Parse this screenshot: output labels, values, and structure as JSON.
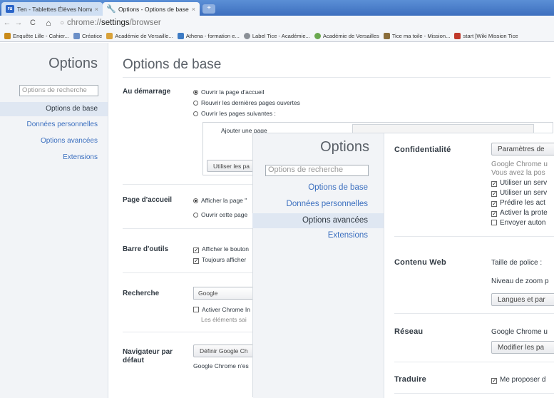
{
  "tabs": [
    {
      "label": "Ten - Tablettes Élèves Nomad",
      "favicon": "ru-logo-icon",
      "close": "×"
    },
    {
      "label": "Options - Options de base",
      "favicon": "wrench-icon",
      "close": "×"
    }
  ],
  "new_tab_label": "+",
  "toolbar": {
    "back": "←",
    "forward": "→",
    "reload": "C",
    "home": "⌂",
    "url_scheme": "chrome://",
    "url_host": "settings",
    "url_path": "/browser"
  },
  "bookmarks": [
    {
      "label": "Enquête Lille - Cahier...",
      "color": "#c98a1a"
    },
    {
      "label": "Créatice",
      "color": "#6b8fc7"
    },
    {
      "label": "Académie de Versaille...",
      "color": "#d9a23a"
    },
    {
      "label": "Athena - formation e...",
      "color": "#3d7bc4"
    },
    {
      "label": "Label Tice - Académie...",
      "color": "#8a8f96"
    },
    {
      "label": "Académie de Versailles",
      "color": "#6aa84f"
    },
    {
      "label": "Tice ma toile - Mission...",
      "color": "#8a6d3b"
    },
    {
      "label": "start [Wiki Mission Tice",
      "color": "#c0392b"
    }
  ],
  "background": {
    "sidebar": {
      "title": "Options",
      "search_placeholder": "Options de recherche",
      "items": [
        "Options de base",
        "Données personnelles",
        "Options avancées",
        "Extensions"
      ]
    },
    "title": "Options de base",
    "startup": {
      "label": "Au démarrage",
      "options": [
        "Ouvrir la page d'accueil",
        "Rouvrir les dernières pages ouvertes",
        "Ouvrir les pages suivantes :"
      ],
      "add_page": "Ajouter une page",
      "use_current": "Utiliser les pa"
    },
    "homepage": {
      "label": "Page d'accueil",
      "options": [
        "Afficher la page \"",
        "Ouvrir cette page"
      ]
    },
    "toolbar_section": {
      "label": "Barre d'outils",
      "options": [
        "Afficher le bouton",
        "Toujours afficher"
      ]
    },
    "search": {
      "label": "Recherche",
      "engine": "Google",
      "instant": "Activer Chrome In",
      "instant_note": "Les éléments sai"
    },
    "default_browser": {
      "label_line1": "Navigateur par",
      "label_line2": "défaut",
      "button": "Définir Google Ch",
      "note": "Google Chrome n'es"
    }
  },
  "overlay": {
    "sidebar": {
      "title": "Options",
      "search_placeholder": "Options de recherche",
      "items": [
        "Options de base",
        "Données personnelles",
        "Options avancées",
        "Extensions"
      ]
    },
    "privacy": {
      "label": "Confidentialité",
      "button": "Paramètres de",
      "note1": "Google Chrome u",
      "note2": "Vous avez la pos",
      "checks": [
        "Utiliser un serv",
        "Utiliser un serv",
        "Prédire les act",
        "Activer la prote",
        "Envoyer auton"
      ]
    },
    "web_content": {
      "label": "Contenu Web",
      "font_size": "Taille de police :",
      "zoom": "Niveau de zoom p",
      "button": "Langues et par"
    },
    "network": {
      "label": "Réseau",
      "note": "Google Chrome u",
      "button": "Modifier les pa"
    },
    "translate": {
      "label": "Traduire",
      "check": "Me proposer d"
    }
  }
}
